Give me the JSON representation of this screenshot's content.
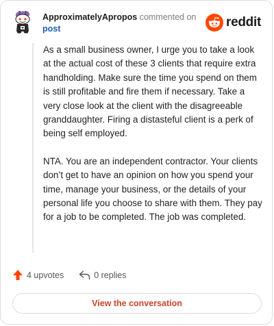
{
  "header": {
    "username": "ApproximatelyApropos",
    "action_text": "commented on",
    "link_text": "post",
    "brand": "reddit",
    "brand_color": "#FF4500"
  },
  "comment": {
    "paragraphs": [
      "As a small business owner, I urge you to take a look at the actual cost of these 3 clients that require extra handholding. Make sure the time you spend on them is still profitable and fire them if necessary. Take a very close look at the client with the disagreeable granddaughter. Firing a distasteful client is a perk of being self employed.",
      "NTA. You are an independent contractor. Your clients don’t get to have an opinion on how you spend your time, manage your business, or the details of your personal life you choose to share with them. They pay for a job to be completed. The job was completed."
    ]
  },
  "actions": {
    "upvotes_label": "4 upvotes",
    "replies_label": "0 replies",
    "upvote_icon": "upvote-arrow-icon",
    "reply_icon": "reply-arrow-icon",
    "upvote_color": "#FF4500"
  },
  "footer": {
    "button_label": "View the conversation",
    "button_color": "#C9452A"
  }
}
